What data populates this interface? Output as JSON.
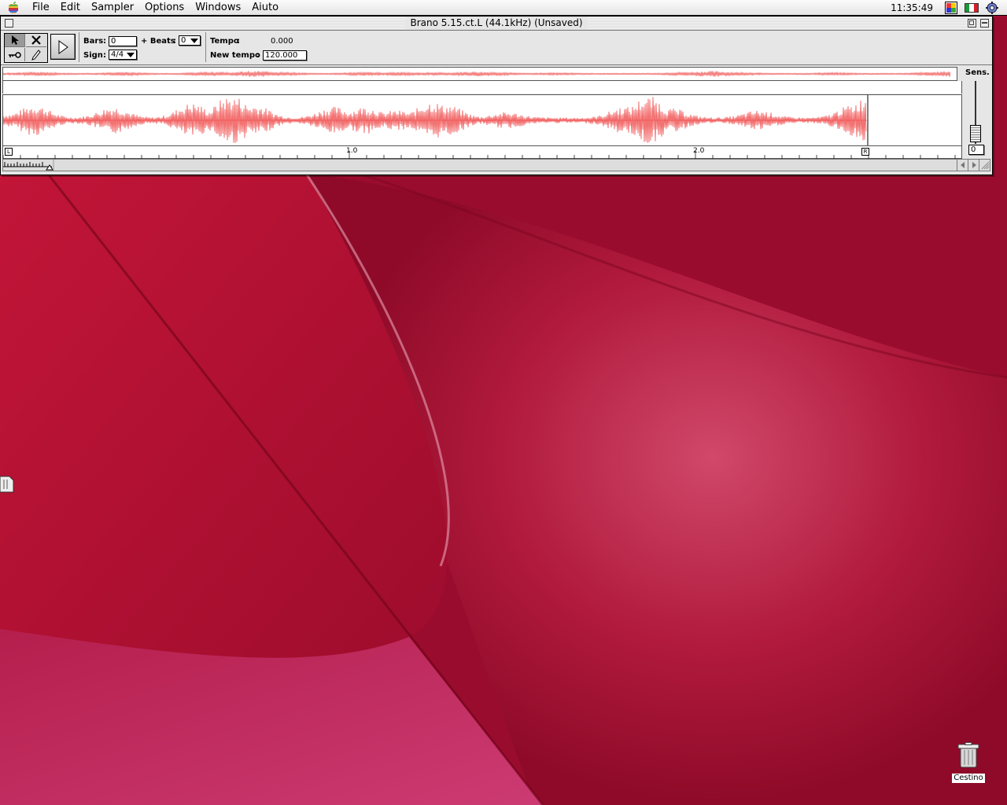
{
  "menubar": {
    "apple_icon": "apple-icon",
    "items": [
      "File",
      "Edit",
      "Sampler",
      "Options",
      "Windows",
      "Aiuto"
    ],
    "clock": "11:35:49",
    "right_icons": [
      "colorsync-icon",
      "italian-flag-icon",
      "application-switcher-icon"
    ]
  },
  "window": {
    "title": "Brano  5.15.ct.L (44.1kHz) (Unsaved)",
    "toolbar": {
      "tools": [
        "arrow-select-icon",
        "erase-x-icon",
        "key-icon",
        "pencil-icon"
      ],
      "play_icon": "play-icon",
      "bars_label": "Bars",
      "bars_value": "0",
      "beats_label": "+ Beats",
      "beats_value": "0",
      "sign_label": "Sign",
      "sign_value": "4/4",
      "tempo_label": "Tempo",
      "tempo_value": "0.000",
      "new_tempo_label": "New tempo",
      "new_tempo_value": "120.000"
    },
    "ruler": {
      "labels": [
        "1.0",
        "2.0"
      ],
      "start_marker": "L",
      "end_marker": "R"
    },
    "sens": {
      "label": "Sens.",
      "value": "0"
    },
    "waveform_color": "#f05050"
  },
  "desktop": {
    "trash_label": "Cestino",
    "background_color": "#b8123a"
  }
}
